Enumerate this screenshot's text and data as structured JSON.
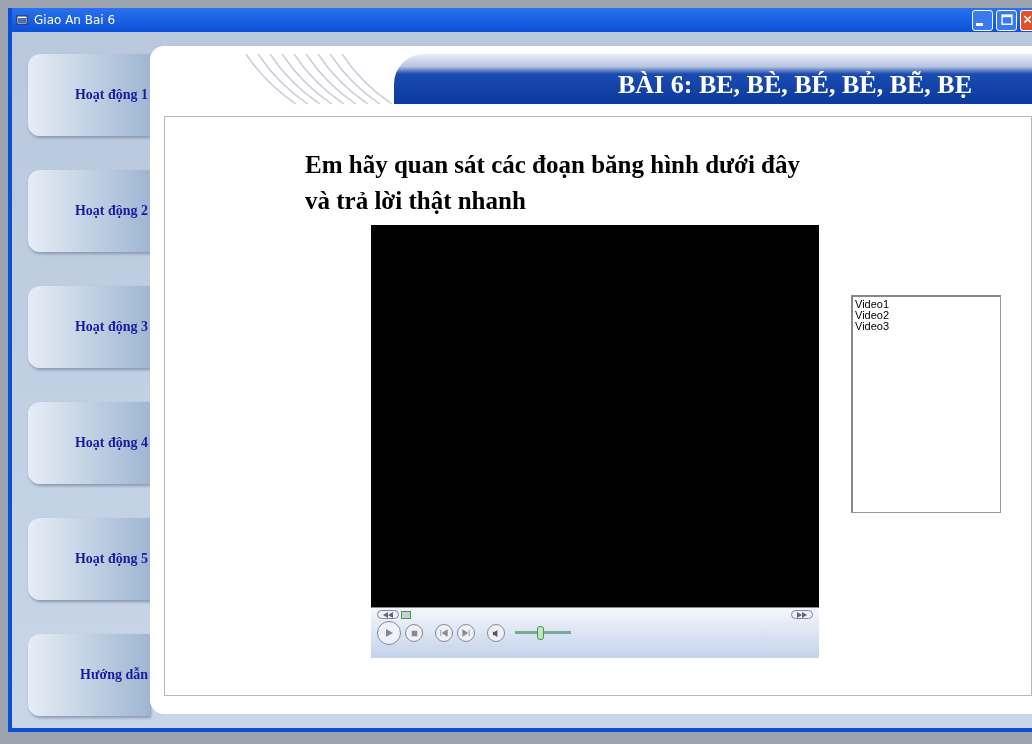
{
  "window": {
    "title": "Giao An Bai 6"
  },
  "sidebar": {
    "items": [
      {
        "label": "Hoạt động 1"
      },
      {
        "label": "Hoạt động 2"
      },
      {
        "label": "Hoạt động 3"
      },
      {
        "label": "Hoạt động 4"
      },
      {
        "label": "Hoạt động 5"
      },
      {
        "label": "Hướng dẫn"
      }
    ]
  },
  "header": {
    "title": "BÀI 6:  BE, BÈ, BÉ, BẺ, BẼ, BẸ"
  },
  "content": {
    "instruction_lines": [
      "Em hãy quan sát các đoạn băng hình dưới đây",
      "và trả lời thật nhanh"
    ]
  },
  "player": {
    "seek": {
      "level": 0.0
    },
    "volume": {
      "level": 0.45
    }
  },
  "video_list": {
    "items": [
      "Video1",
      "Video2",
      "Video3"
    ]
  }
}
